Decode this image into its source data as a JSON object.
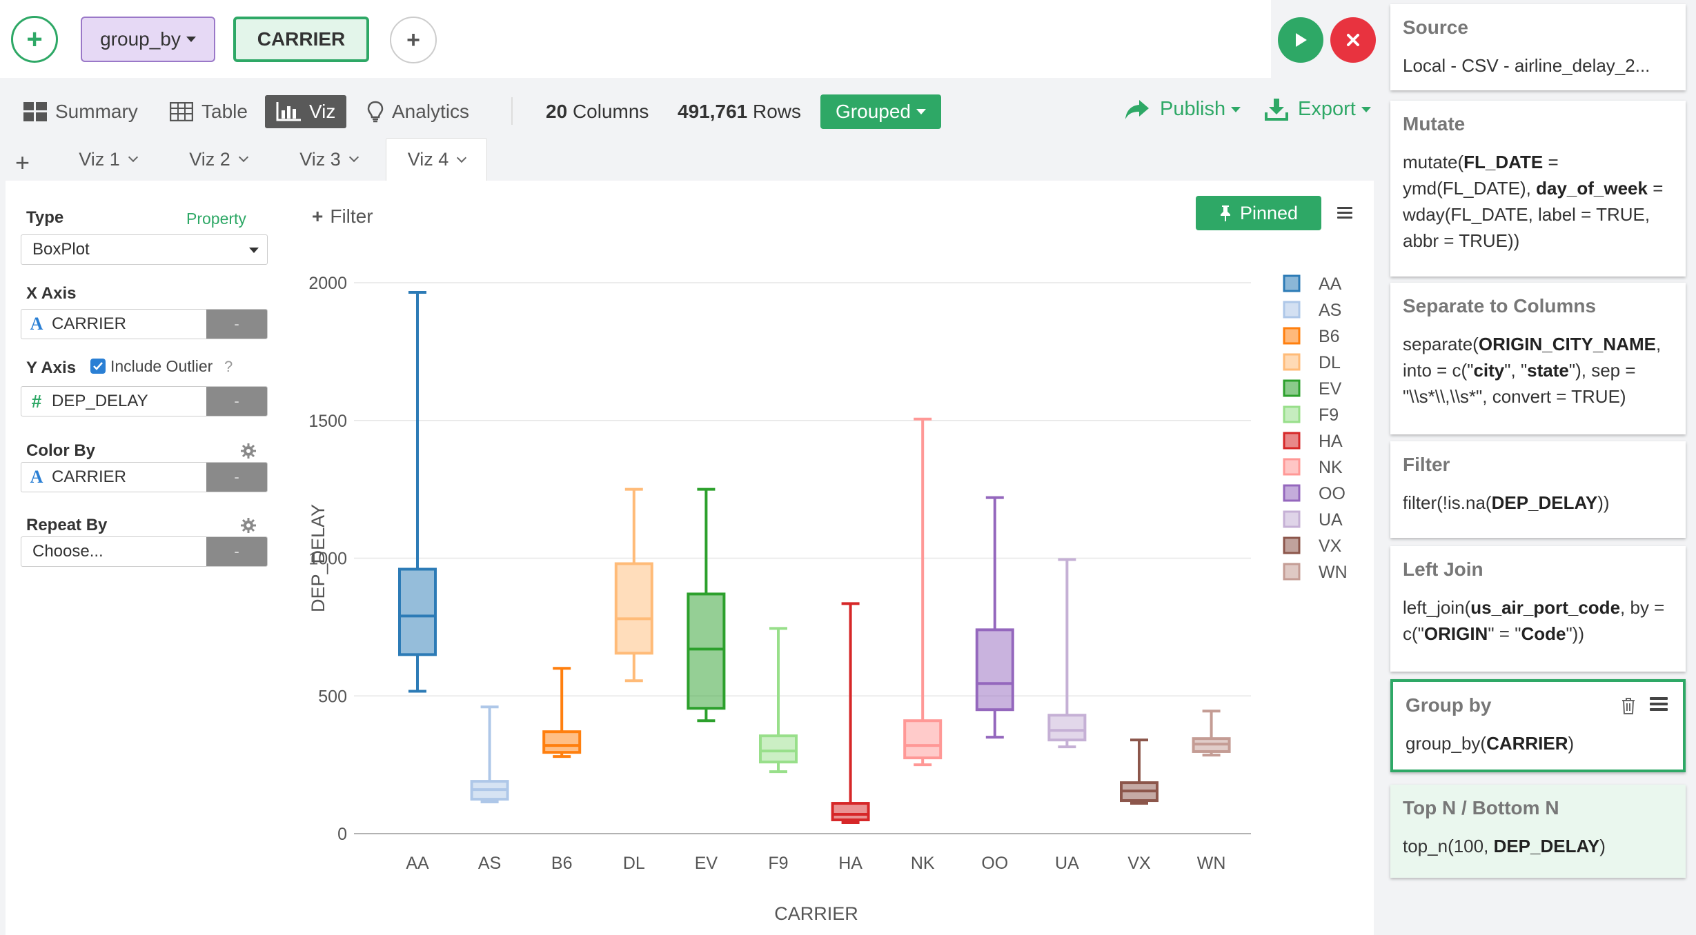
{
  "command_bar": {
    "command_label": "group_by",
    "column_chip": "CARRIER"
  },
  "nav": {
    "tabs": [
      {
        "label": "Summary",
        "icon": "summary-icon"
      },
      {
        "label": "Table",
        "icon": "table-icon"
      },
      {
        "label": "Viz",
        "icon": "bar-chart-icon",
        "active": true
      },
      {
        "label": "Analytics",
        "icon": "lightbulb-icon"
      }
    ],
    "columns_count": "20",
    "columns_label": "Columns",
    "rows_count": "491,761",
    "rows_label": "Rows",
    "grouped_label": "Grouped",
    "publish_label": "Publish",
    "export_label": "Export"
  },
  "viz_tabs": [
    "Viz 1",
    "Viz 2",
    "Viz 3",
    "Viz 4"
  ],
  "active_viz_tab": "Viz 4",
  "properties": {
    "type_label": "Type",
    "property_link": "Property",
    "type_value": "BoxPlot",
    "x_axis_label": "X Axis",
    "x_axis_field": "CARRIER",
    "y_axis_label": "Y Axis",
    "include_outlier_label": "Include Outlier",
    "include_outlier_checked": true,
    "help_mark": "?",
    "y_axis_field": "DEP_DELAY",
    "color_by_label": "Color By",
    "color_by_field": "CARRIER",
    "repeat_by_label": "Repeat By",
    "repeat_by_placeholder": "Choose...",
    "remove_label": "-"
  },
  "toolbar": {
    "filter_label": "Filter",
    "pinned_label": "Pinned"
  },
  "chart_data": {
    "type": "boxplot",
    "xlabel": "CARRIER",
    "ylabel": "DEP_DELAY",
    "ylim": [
      0,
      2000
    ],
    "yticks": [
      0,
      500,
      1000,
      1500,
      2000
    ],
    "grid": true,
    "legend_position": "right",
    "categories": [
      "AA",
      "AS",
      "B6",
      "DL",
      "EV",
      "F9",
      "HA",
      "NK",
      "OO",
      "UA",
      "VX",
      "WN"
    ],
    "series": [
      {
        "name": "AA",
        "color": "#2c7bb6",
        "min": 517,
        "q1": 650,
        "median": 790,
        "q3": 960,
        "max": 1965
      },
      {
        "name": "AS",
        "color": "#aec7e8",
        "min": 115,
        "q1": 125,
        "median": 160,
        "q3": 190,
        "max": 460
      },
      {
        "name": "B6",
        "color": "#ff7f0e",
        "min": 280,
        "q1": 295,
        "median": 320,
        "q3": 370,
        "max": 600
      },
      {
        "name": "DL",
        "color": "#ffbb78",
        "min": 555,
        "q1": 655,
        "median": 780,
        "q3": 980,
        "max": 1250
      },
      {
        "name": "EV",
        "color": "#2ca02c",
        "min": 410,
        "q1": 455,
        "median": 670,
        "q3": 870,
        "max": 1250
      },
      {
        "name": "F9",
        "color": "#98df8a",
        "min": 225,
        "q1": 260,
        "median": 300,
        "q3": 355,
        "max": 745
      },
      {
        "name": "HA",
        "color": "#d62728",
        "min": 40,
        "q1": 50,
        "median": 70,
        "q3": 110,
        "max": 835
      },
      {
        "name": "NK",
        "color": "#ff9896",
        "min": 250,
        "q1": 275,
        "median": 320,
        "q3": 410,
        "max": 1505
      },
      {
        "name": "OO",
        "color": "#9467bd",
        "min": 350,
        "q1": 450,
        "median": 545,
        "q3": 740,
        "max": 1220
      },
      {
        "name": "UA",
        "color": "#c5b0d5",
        "min": 315,
        "q1": 340,
        "median": 375,
        "q3": 430,
        "max": 995
      },
      {
        "name": "VX",
        "color": "#8c564b",
        "min": 110,
        "q1": 120,
        "median": 155,
        "q3": 185,
        "max": 340
      },
      {
        "name": "WN",
        "color": "#c49c94",
        "min": 285,
        "q1": 298,
        "median": 325,
        "q3": 345,
        "max": 445
      }
    ]
  },
  "steps": [
    {
      "title": "Source",
      "body_html": "Local - CSV - airline_delay_2..."
    },
    {
      "title": "Mutate",
      "body_html": "mutate(<b>FL_DATE</b> = ymd(FL_DATE), <b>day_of_week</b> = wday(FL_DATE, label = TRUE, abbr = TRUE))"
    },
    {
      "title": "Separate to Columns",
      "body_html": "separate(<b>ORIGIN_CITY_NAME</b>, into = c(\"<b>city</b>\", \"<b>state</b>\"), sep = \"\\\\s*\\\\,\\\\s*\", convert = TRUE)"
    },
    {
      "title": "Filter",
      "body_html": "filter(!is.na(<b>DEP_DELAY</b>))"
    },
    {
      "title": "Left Join",
      "body_html": "left_join(<b>us_air_port_code</b>, by = c(\"<b>ORIGIN</b>\" = \"<b>Code</b>\"))"
    },
    {
      "title": "Group by",
      "body_html": "group_by(<b>CARRIER</b>)",
      "selected": true
    },
    {
      "title": "Top N / Bottom N",
      "body_html": "top_n(100, <b>DEP_DELAY</b>)",
      "faded": true
    }
  ]
}
